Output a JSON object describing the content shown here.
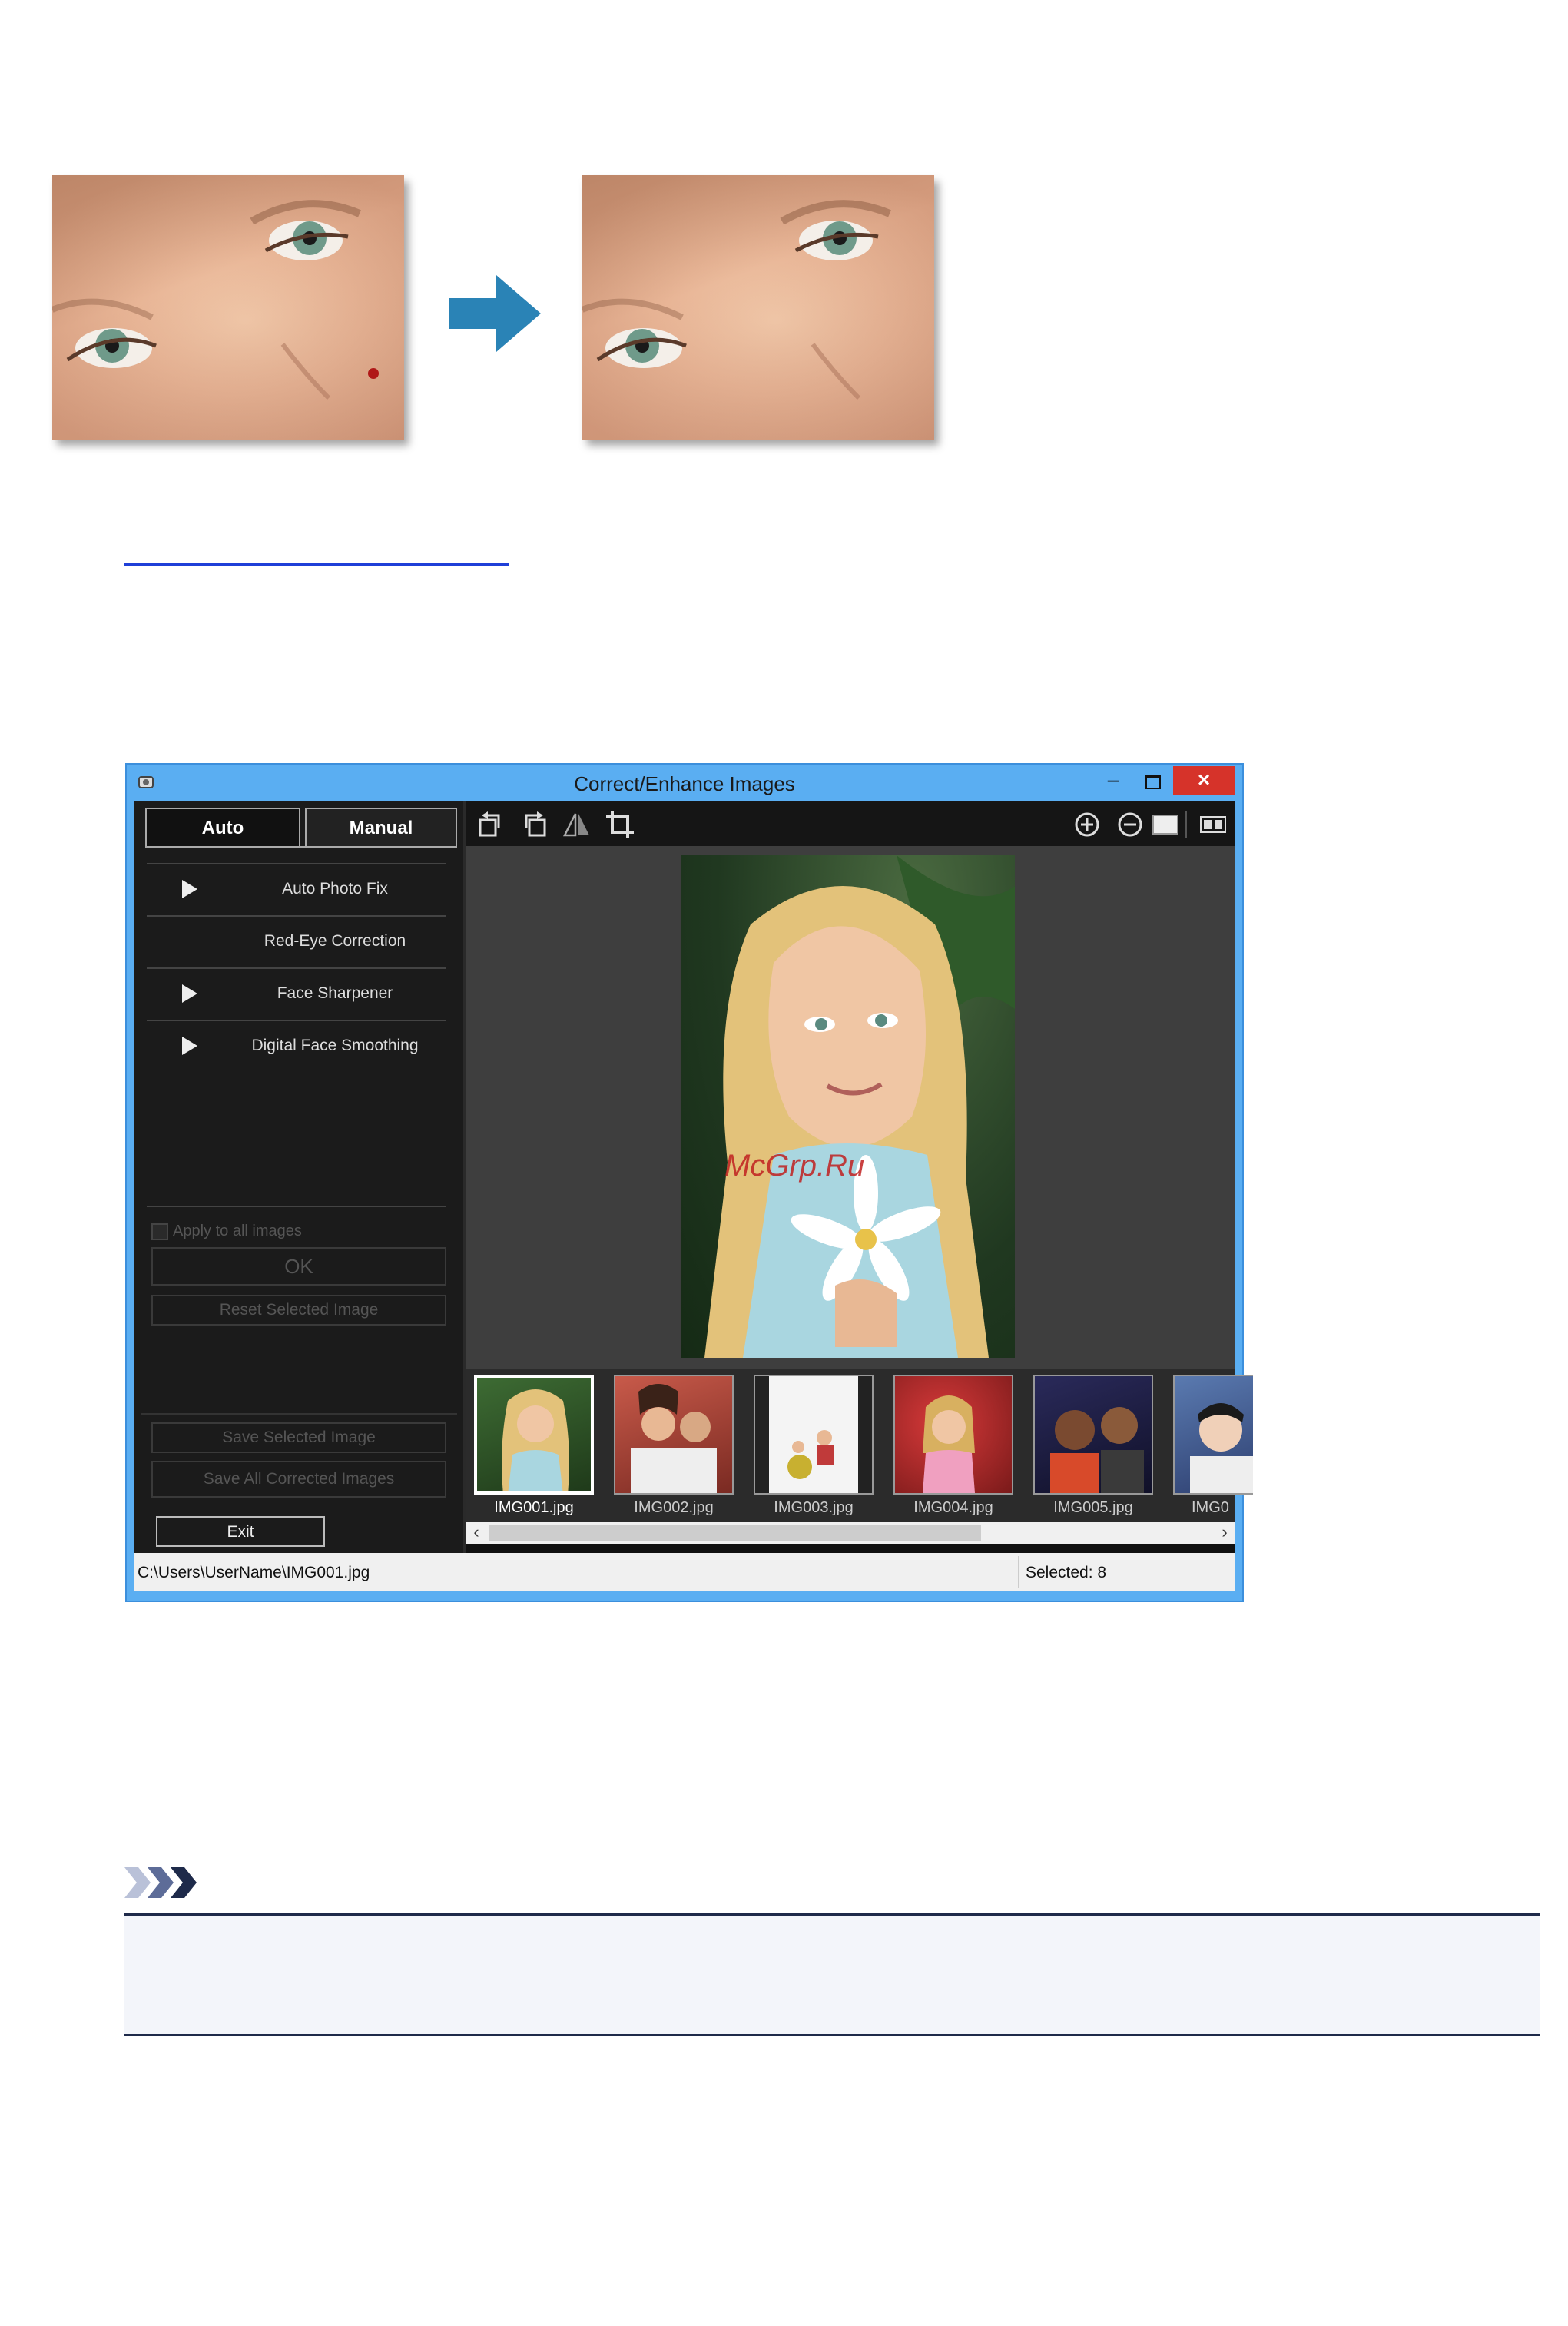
{
  "window": {
    "title": "Correct/Enhance Images",
    "minimize": "–",
    "close": "×"
  },
  "tabs": {
    "auto": "Auto",
    "manual": "Manual"
  },
  "fixes": [
    {
      "label": "Auto Photo Fix",
      "has_arrow": true
    },
    {
      "label": "Red-Eye Correction",
      "has_arrow": false
    },
    {
      "label": "Face Sharpener",
      "has_arrow": true
    },
    {
      "label": "Digital Face Smoothing",
      "has_arrow": true
    }
  ],
  "options": {
    "apply_all": "Apply to all images",
    "ok": "OK",
    "reset": "Reset Selected Image",
    "save_selected": "Save Selected Image",
    "save_all": "Save All Corrected Images",
    "exit": "Exit"
  },
  "toolbar": {
    "icons": [
      "rotate-left-icon",
      "rotate-right-icon",
      "flip-icon",
      "crop-icon",
      "zoom-in-icon",
      "zoom-out-icon",
      "full-screen-icon",
      "compare-view-icon"
    ]
  },
  "preview": {
    "watermark": "McGrp.Ru"
  },
  "thumbnails": [
    {
      "name": "IMG001.jpg",
      "selected": true
    },
    {
      "name": "IMG002.jpg",
      "selected": false
    },
    {
      "name": "IMG003.jpg",
      "selected": false
    },
    {
      "name": "IMG004.jpg",
      "selected": false
    },
    {
      "name": "IMG005.jpg",
      "selected": false
    },
    {
      "name": "IMG0",
      "selected": false
    }
  ],
  "status": {
    "path": "C:\\Users\\UserName\\IMG001.jpg",
    "selected": "Selected: 8"
  },
  "colors": {
    "titlebar": "#5aaef2",
    "close_button": "#d6332a",
    "arrow": "#2a83b6",
    "link": "#1f3fd8",
    "note_chevrons": "#1e2a4a"
  }
}
